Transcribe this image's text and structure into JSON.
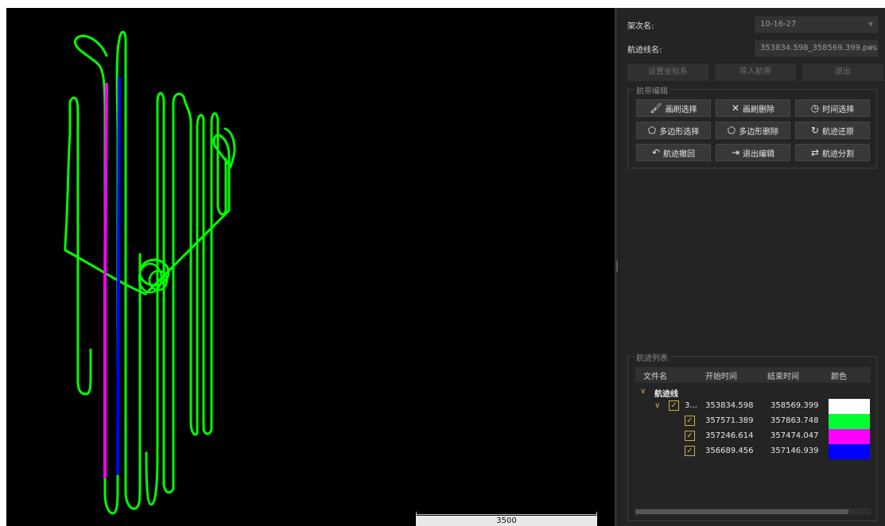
{
  "map": {
    "scale_label": "3500",
    "track_colors": {
      "outline": "#00ff00",
      "magenta": "#ff00ff",
      "blue": "#0000ff"
    }
  },
  "panel": {
    "flight_label": "架次名:",
    "flight_value": "10-16-27",
    "track_label": "航迹线名:",
    "track_value": "353834.598_358569.399.pos",
    "buttons": {
      "set_coord": "设置坐标系",
      "import_strip": "导入航带",
      "exit": "退出"
    },
    "edit_group": {
      "title": "航带编辑",
      "brush_select": "画刷选择",
      "brush_delete": "画刷删除",
      "time_select": "时间选择",
      "polygon_select": "多边形选择",
      "polygon_delete": "多边形删除",
      "track_restore": "航迹还原",
      "track_undo": "航迹撤回",
      "exit_edit": "退出编辑",
      "track_split": "航迹分割"
    },
    "list_group": {
      "title": "航迹列表",
      "columns": [
        "文件名",
        "开始时间",
        "结束时间",
        "颜色"
      ],
      "root_label": "航迹线",
      "rows": [
        {
          "name": "3...",
          "start": "353834.598",
          "end": "358569.399",
          "color": "#ffffff"
        },
        {
          "name": "",
          "start": "357571.389",
          "end": "357863.748",
          "color": "#00ff33"
        },
        {
          "name": "",
          "start": "357246.614",
          "end": "357474.047",
          "color": "#ff00ff"
        },
        {
          "name": "",
          "start": "356689.456",
          "end": "357146.939",
          "color": "#0000ff"
        }
      ]
    }
  }
}
